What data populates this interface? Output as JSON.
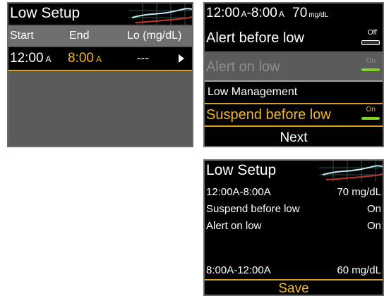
{
  "screen1": {
    "title": "Low Setup",
    "headers": {
      "start": "Start",
      "end": "End",
      "lo": "Lo (mg/dL)"
    },
    "row": {
      "start": "12:00",
      "start_suffix": "A",
      "end": "8:00",
      "end_suffix": "A",
      "lo": "---"
    }
  },
  "screen2": {
    "header": {
      "start": "12:00",
      "start_suffix": "A",
      "dash": "-",
      "end": "8:00",
      "end_suffix": "A",
      "value": "70",
      "unit": "mg/dL"
    },
    "alert_before_low": {
      "label": "Alert before low",
      "toggle": "Off"
    },
    "alert_on_low": {
      "label": "Alert on low",
      "toggle": "On"
    },
    "low_management": "Low Management",
    "suspend_before_low": {
      "label": "Suspend before low",
      "toggle": "On"
    },
    "next": "Next"
  },
  "screen3": {
    "title": "Low Setup",
    "rows": [
      {
        "left": "12:00A-8:00A",
        "right": "70 mg/dL"
      },
      {
        "left": "Suspend before low",
        "right": "On"
      },
      {
        "left": "Alert on low",
        "right": "On"
      },
      {
        "left": "",
        "right": ""
      },
      {
        "left": "8:00A-12:00A",
        "right": "60 mg/dL"
      }
    ],
    "save": "Save"
  },
  "colors": {
    "accent": "#f4b827",
    "toggle_on": "#7ed321",
    "panel": "#5b5b5b"
  },
  "icons": {
    "row_arrow": "arrow-right-icon",
    "graph": "graph-icon"
  }
}
